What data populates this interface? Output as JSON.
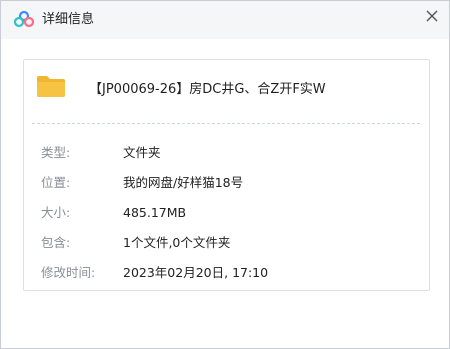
{
  "window": {
    "title": "详细信息",
    "icons": {
      "app": "baidu-netdisk-cloud-icon",
      "close": "close-icon",
      "file": "folder-icon"
    }
  },
  "file": {
    "name": "【JP00069-26】房DC井G、合Z开F实W"
  },
  "details": [
    {
      "label": "类型:",
      "value": "文件夹"
    },
    {
      "label": "位置:",
      "value": "我的网盘/好样猫18号"
    },
    {
      "label": "大小:",
      "value": "485.17MB"
    },
    {
      "label": "包含:",
      "value": "1个文件,0个文件夹"
    },
    {
      "label": "修改时间:",
      "value": "2023年02月20日, 17:10"
    }
  ],
  "colors": {
    "folder": "#f6c343",
    "logo_blue": "#3d8bfd",
    "logo_teal": "#2bc3c7",
    "logo_pink": "#ff6a85"
  }
}
